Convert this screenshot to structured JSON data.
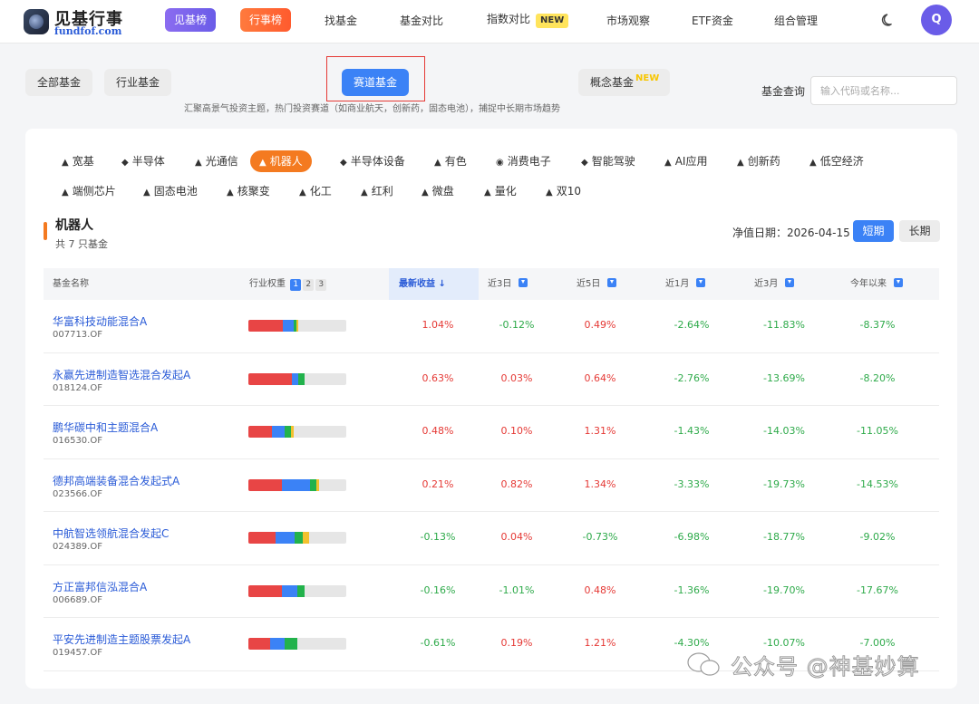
{
  "logo": {
    "title": "见基行事",
    "subtitle": "fundfof.com"
  },
  "nav": {
    "primary": [
      "见基榜",
      "行事榜"
    ],
    "items": [
      {
        "label": "找基金",
        "badge": ""
      },
      {
        "label": "基金对比",
        "badge": ""
      },
      {
        "label": "指数对比",
        "badge": "NEW"
      },
      {
        "label": "市场观察",
        "badge": ""
      },
      {
        "label": "ETF资金",
        "badge": ""
      },
      {
        "label": "组合管理",
        "badge": ""
      }
    ],
    "avatar": "Q"
  },
  "subtabs": {
    "items": [
      "全部基金",
      "行业基金",
      "赛道基金",
      "概念基金"
    ],
    "active": "赛道基金",
    "new_tag": "NEW",
    "description": "汇聚高景气投资主题，热门投资赛道（如商业航天，创新药，固态电池），捕捉中长期市场趋势"
  },
  "query": {
    "label": "基金查询",
    "placeholder": "输入代码或名称..."
  },
  "tracks": {
    "row1": [
      {
        "mark": "▲",
        "label": "宽基"
      },
      {
        "mark": "◆",
        "label": "半导体"
      },
      {
        "mark": "▲",
        "label": "光通信"
      },
      {
        "mark": "▲",
        "label": "机器人"
      },
      {
        "mark": "◆",
        "label": "半导体设备"
      },
      {
        "mark": "▲",
        "label": "有色"
      },
      {
        "mark": "◉",
        "label": "消费电子"
      },
      {
        "mark": "◆",
        "label": "智能驾驶"
      },
      {
        "mark": "▲",
        "label": "AI应用"
      },
      {
        "mark": "▲",
        "label": "创新药"
      },
      {
        "mark": "▲",
        "label": "低空经济"
      }
    ],
    "row2": [
      {
        "mark": "▲",
        "label": "端侧芯片"
      },
      {
        "mark": "▲",
        "label": "固态电池"
      },
      {
        "mark": "▲",
        "label": "核聚变"
      },
      {
        "mark": "▲",
        "label": "化工"
      },
      {
        "mark": "▲",
        "label": "红利"
      },
      {
        "mark": "▲",
        "label": "微盘"
      },
      {
        "mark": "▲",
        "label": "量化"
      },
      {
        "mark": "▲",
        "label": "双10"
      }
    ],
    "active": "机器人"
  },
  "section": {
    "title": "机器人",
    "count": "共 7 只基金",
    "nav_date_label": "净值日期：",
    "nav_date": "2026-04-15",
    "period_short": "短期",
    "period_long": "长期"
  },
  "table": {
    "headers": {
      "name": "基金名称",
      "weight": "行业权重",
      "latest": "最新收益 ↓",
      "d3": "近3日",
      "d5": "近5日",
      "m1": "近1月",
      "m3": "近3月",
      "ytd": "今年以来"
    },
    "weight_pages": [
      "1",
      "2",
      "3"
    ],
    "bar_colors": [
      "#e84545",
      "#3b82f6",
      "#22b24c",
      "#f2c12e"
    ],
    "rows": [
      {
        "name": "华富科技动能混合A",
        "code": "007713.OF",
        "weights": [
          0.35,
          0.11,
          0.03,
          0.02
        ],
        "latest": "1.04%",
        "d3": "-0.12%",
        "d5": "0.49%",
        "m1": "-2.64%",
        "m3": "-11.83%",
        "ytd": "-8.37%"
      },
      {
        "name": "永赢先进制造智选混合发起A",
        "code": "018124.OF",
        "weights": [
          0.44,
          0.07,
          0.06,
          0.0
        ],
        "latest": "0.63%",
        "d3": "0.03%",
        "d5": "0.64%",
        "m1": "-2.76%",
        "m3": "-13.69%",
        "ytd": "-8.20%"
      },
      {
        "name": "鹏华碳中和主题混合A",
        "code": "016530.OF",
        "weights": [
          0.24,
          0.13,
          0.07,
          0.02
        ],
        "latest": "0.48%",
        "d3": "0.10%",
        "d5": "1.31%",
        "m1": "-1.43%",
        "m3": "-14.03%",
        "ytd": "-11.05%"
      },
      {
        "name": "德邦高端装备混合发起式A",
        "code": "023566.OF",
        "weights": [
          0.34,
          0.29,
          0.06,
          0.03
        ],
        "latest": "0.21%",
        "d3": "0.82%",
        "d5": "1.34%",
        "m1": "-3.33%",
        "m3": "-19.73%",
        "ytd": "-14.53%"
      },
      {
        "name": "中航智选领航混合发起C",
        "code": "024389.OF",
        "weights": [
          0.28,
          0.19,
          0.09,
          0.06
        ],
        "latest": "-0.13%",
        "d3": "0.04%",
        "d5": "-0.73%",
        "m1": "-6.98%",
        "m3": "-18.77%",
        "ytd": "-9.02%"
      },
      {
        "name": "方正富邦信泓混合A",
        "code": "006689.OF",
        "weights": [
          0.34,
          0.16,
          0.07,
          0.0
        ],
        "latest": "-0.16%",
        "d3": "-1.01%",
        "d5": "0.48%",
        "m1": "-1.36%",
        "m3": "-19.70%",
        "ytd": "-17.67%"
      },
      {
        "name": "平安先进制造主题股票发起A",
        "code": "019457.OF",
        "weights": [
          0.22,
          0.15,
          0.13,
          0.0
        ],
        "latest": "-0.61%",
        "d3": "0.19%",
        "d5": "1.21%",
        "m1": "-4.30%",
        "m3": "-10.07%",
        "ytd": "-7.00%"
      }
    ]
  },
  "watermark": "公众号 @神基妙算"
}
